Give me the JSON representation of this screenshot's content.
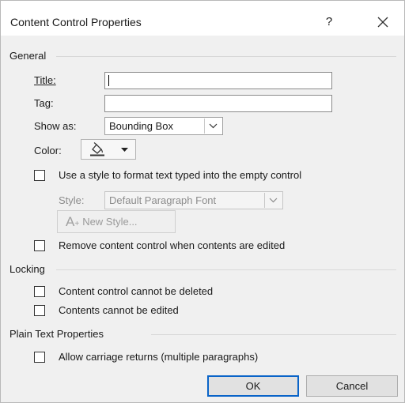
{
  "dialog": {
    "title": "Content Control Properties",
    "help_glyph": "?",
    "close_glyph": "✕"
  },
  "general": {
    "heading": "General",
    "title_label": "Title:",
    "title_value": "",
    "tag_label": "Tag:",
    "tag_value": "",
    "show_as_label": "Show as:",
    "show_as_value": "Bounding Box",
    "color_label": "Color:",
    "use_style_label": "Use a style to format text typed into the empty control",
    "style_label": "Style:",
    "style_value": "Default Paragraph Font",
    "new_style_label": "New Style...",
    "remove_label": "Remove content control when contents are edited"
  },
  "locking": {
    "heading": "Locking",
    "cannot_delete_label": "Content control cannot be deleted",
    "cannot_edit_label": "Contents cannot be edited"
  },
  "plain_text": {
    "heading": "Plain Text Properties",
    "allow_returns_label": "Allow carriage returns (multiple paragraphs)"
  },
  "buttons": {
    "ok": "OK",
    "cancel": "Cancel"
  },
  "colors": {
    "window_bg": "#f0f0f0",
    "default_button_border": "#0a64c8"
  }
}
